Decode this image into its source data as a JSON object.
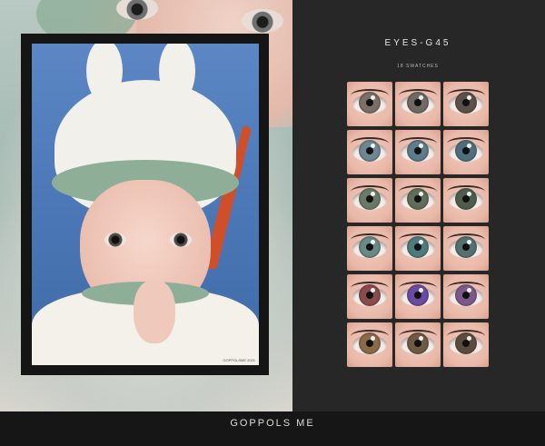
{
  "header": {
    "title": "EYES-G45",
    "subtitle": "18 SWATCHES"
  },
  "photo": {
    "caption": "GOPPOLSME 2021"
  },
  "footer": {
    "text": "GOPPOLS ME"
  },
  "swatches": [
    {
      "color": "#7b6f67"
    },
    {
      "color": "#6f6a62"
    },
    {
      "color": "#5c5148"
    },
    {
      "color": "#6f8792"
    },
    {
      "color": "#5e7c8a"
    },
    {
      "color": "#4f6f7e"
    },
    {
      "color": "#6b7a66"
    },
    {
      "color": "#5f6d5a"
    },
    {
      "color": "#4e5d4b"
    },
    {
      "color": "#6a8985"
    },
    {
      "color": "#4f7a7d"
    },
    {
      "color": "#55706f"
    },
    {
      "color": "#8a4b4f"
    },
    {
      "color": "#6a4aa3"
    },
    {
      "color": "#7b5a8a"
    },
    {
      "color": "#8a6a49"
    },
    {
      "color": "#6e5a43"
    },
    {
      "color": "#5d4c3e"
    }
  ]
}
